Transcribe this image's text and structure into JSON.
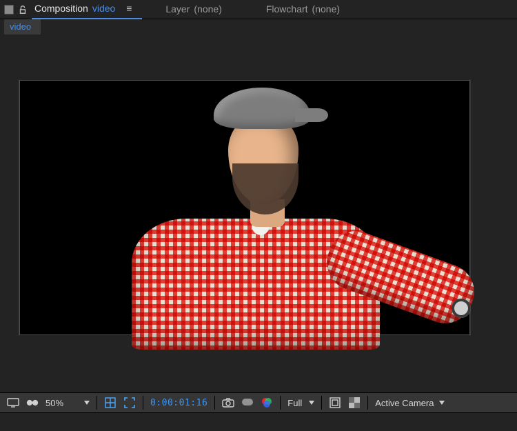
{
  "tabs": {
    "composition": {
      "label": "Composition",
      "comp_name": "video"
    },
    "layer": {
      "label": "Layer",
      "detail": "(none)"
    },
    "flowchart": {
      "label": "Flowchart",
      "detail": "(none)"
    }
  },
  "subtab": {
    "label": "video"
  },
  "footer": {
    "zoom": "50%",
    "timecode": "0:00:01:16",
    "resolution": "Full",
    "camera": "Active Camera"
  }
}
